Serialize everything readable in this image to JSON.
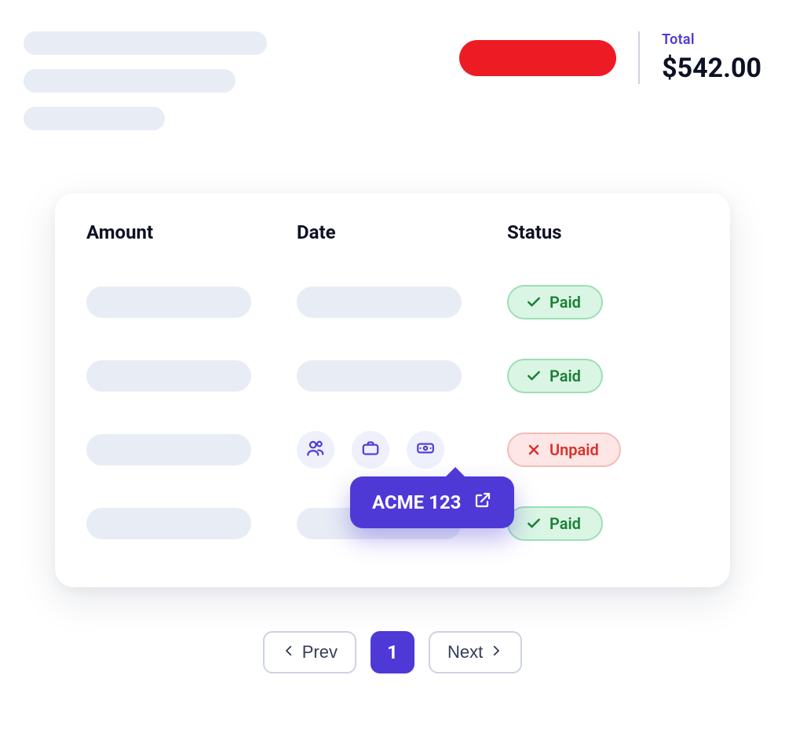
{
  "total": {
    "label": "Total",
    "value": "$542.00"
  },
  "table": {
    "headers": {
      "amount": "Amount",
      "date": "Date",
      "status": "Status"
    },
    "rows": [
      {
        "status_kind": "paid",
        "status_label": "Paid"
      },
      {
        "status_kind": "paid",
        "status_label": "Paid"
      },
      {
        "status_kind": "unpaid",
        "status_label": "Unpaid",
        "has_actions": true
      },
      {
        "status_kind": "paid",
        "status_label": "Paid"
      }
    ]
  },
  "tooltip": {
    "label": "ACME 123"
  },
  "pagination": {
    "prev_label": "Prev",
    "next_label": "Next",
    "current_page": "1"
  },
  "colors": {
    "accent": "#4e39d6",
    "danger": "#ed1c24"
  }
}
